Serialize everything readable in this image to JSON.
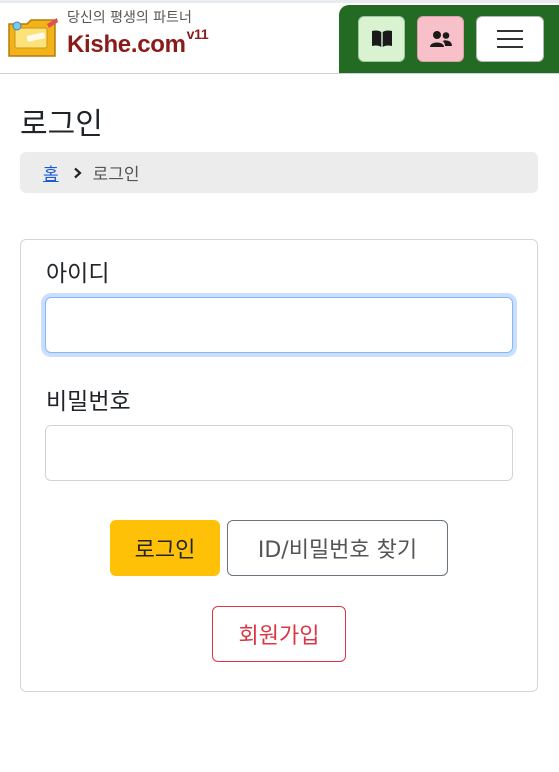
{
  "header": {
    "tagline": "당신의 평생의 파트너",
    "brand": "Kishe.com",
    "version": "v11",
    "icons": {
      "logo": "note-folder-logo",
      "book": "open-book-icon",
      "people": "people-icon",
      "menu": "hamburger-menu-icon"
    },
    "colors": {
      "panel": "#236b23",
      "book_button": "#d9f2d0",
      "people_button": "#f8c0c8",
      "brand_text": "#8b1a1a"
    }
  },
  "page": {
    "title": "로그인"
  },
  "breadcrumb": {
    "home": "홈",
    "separator_icon": "chevron-right-icon",
    "current": "로그인"
  },
  "form": {
    "id_label": "아이디",
    "id_value": "",
    "password_label": "비밀번호",
    "password_value": "",
    "login_button": "로그인",
    "find_button": "ID/비밀번호 찾기",
    "signup_button": "회원가입"
  }
}
